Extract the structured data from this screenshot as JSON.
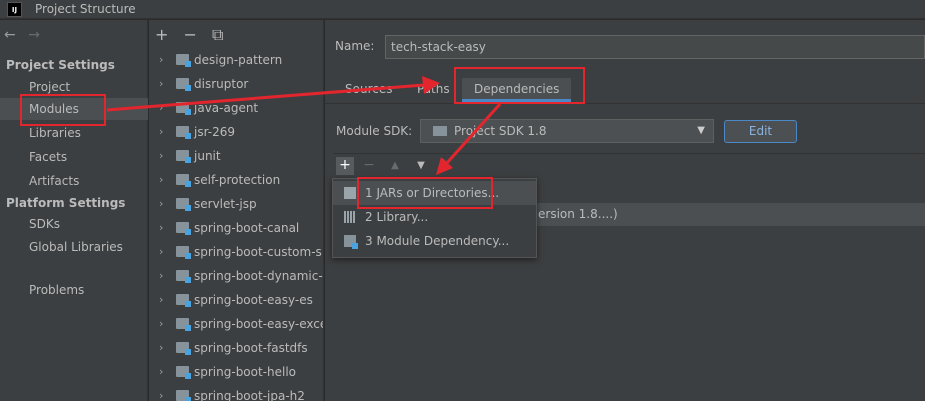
{
  "window": {
    "title": "Project Structure",
    "logo_text": "IJ"
  },
  "nav": {
    "back": "←",
    "forward": "→"
  },
  "sidebar": {
    "project_settings": "Project Settings",
    "project_items": [
      "Project",
      "Modules",
      "Libraries",
      "Facets",
      "Artifacts"
    ],
    "platform_settings": "Platform Settings",
    "platform_items": [
      "SDKs",
      "Global Libraries"
    ],
    "problems": "Problems",
    "selected": "Modules"
  },
  "tree": {
    "toolbar": {
      "add": "+",
      "remove": "−",
      "copy": "⧉"
    },
    "items": [
      "design-pattern",
      "disruptor",
      "java-agent",
      "jsr-269",
      "junit",
      "self-protection",
      "servlet-jsp",
      "spring-boot-canal",
      "spring-boot-custom-s",
      "spring-boot-dynamic-",
      "spring-boot-easy-es",
      "spring-boot-easy-exce",
      "spring-boot-fastdfs",
      "spring-boot-hello",
      "spring-boot-jpa-h2"
    ]
  },
  "main": {
    "name_label": "Name:",
    "name_value": "tech-stack-easy",
    "tabs": [
      "Sources",
      "Paths",
      "Dependencies"
    ],
    "active_tab": "Dependencies",
    "sdk_label": "Module SDK:",
    "sdk_value": "Project SDK 1.8",
    "edit_button": "Edit",
    "dep_row_text": "ersion 1.8....)"
  },
  "toolbar": {
    "add": "+",
    "remove": "−",
    "up": "▲",
    "down": "▼",
    "edit": "✎"
  },
  "popup": {
    "items": [
      "1  JARs or Directories...",
      "2  Library...",
      "3  Module Dependency..."
    ]
  },
  "colors": {
    "annotation": "#e3262e",
    "accent": "#4a88c7",
    "background": "#3c3f41"
  }
}
